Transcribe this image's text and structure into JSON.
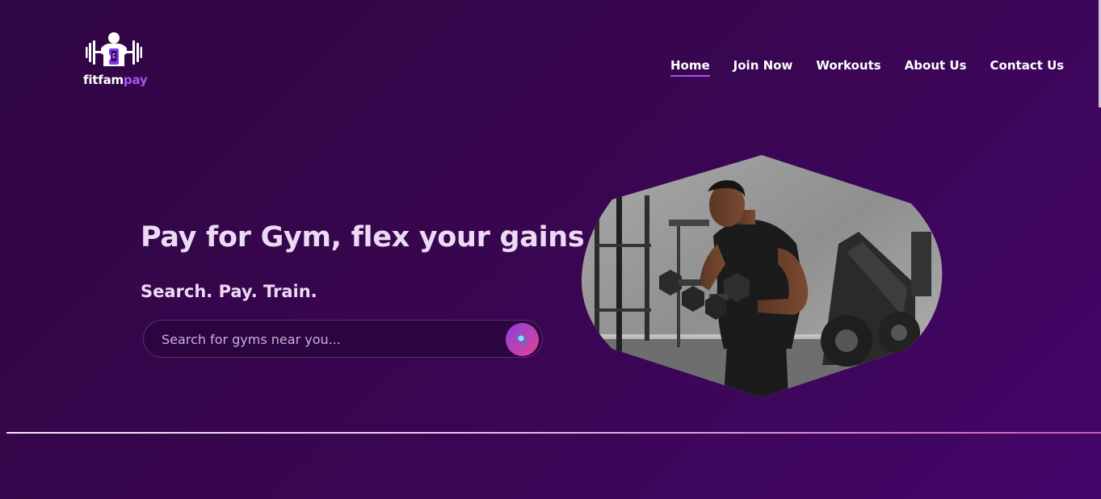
{
  "brand": {
    "name_part1": "fitfam",
    "name_part2": "pay",
    "accent_color": "#a855f7",
    "icon": "bodybuilder-dumbbell-phone-icon"
  },
  "nav": {
    "items": [
      {
        "label": "Home",
        "active": true
      },
      {
        "label": "Join Now",
        "active": false
      },
      {
        "label": "Workouts",
        "active": false
      },
      {
        "label": "About Us",
        "active": false
      },
      {
        "label": "Contact Us",
        "active": false
      }
    ]
  },
  "hero": {
    "title": "Pay for Gym, flex your gains",
    "subtitle": "Search. Pay. Train.",
    "search": {
      "placeholder": "Search for gyms near you...",
      "value": "",
      "button_icon": "search-icon"
    },
    "image": {
      "icon": "gym-athlete-photo"
    }
  },
  "colors": {
    "background_start": "#2f0544",
    "background_end": "#44066a",
    "heading_text": "#ecdaf5",
    "search_gradient_start": "#8b3fe0",
    "search_gradient_end": "#e2438f"
  }
}
